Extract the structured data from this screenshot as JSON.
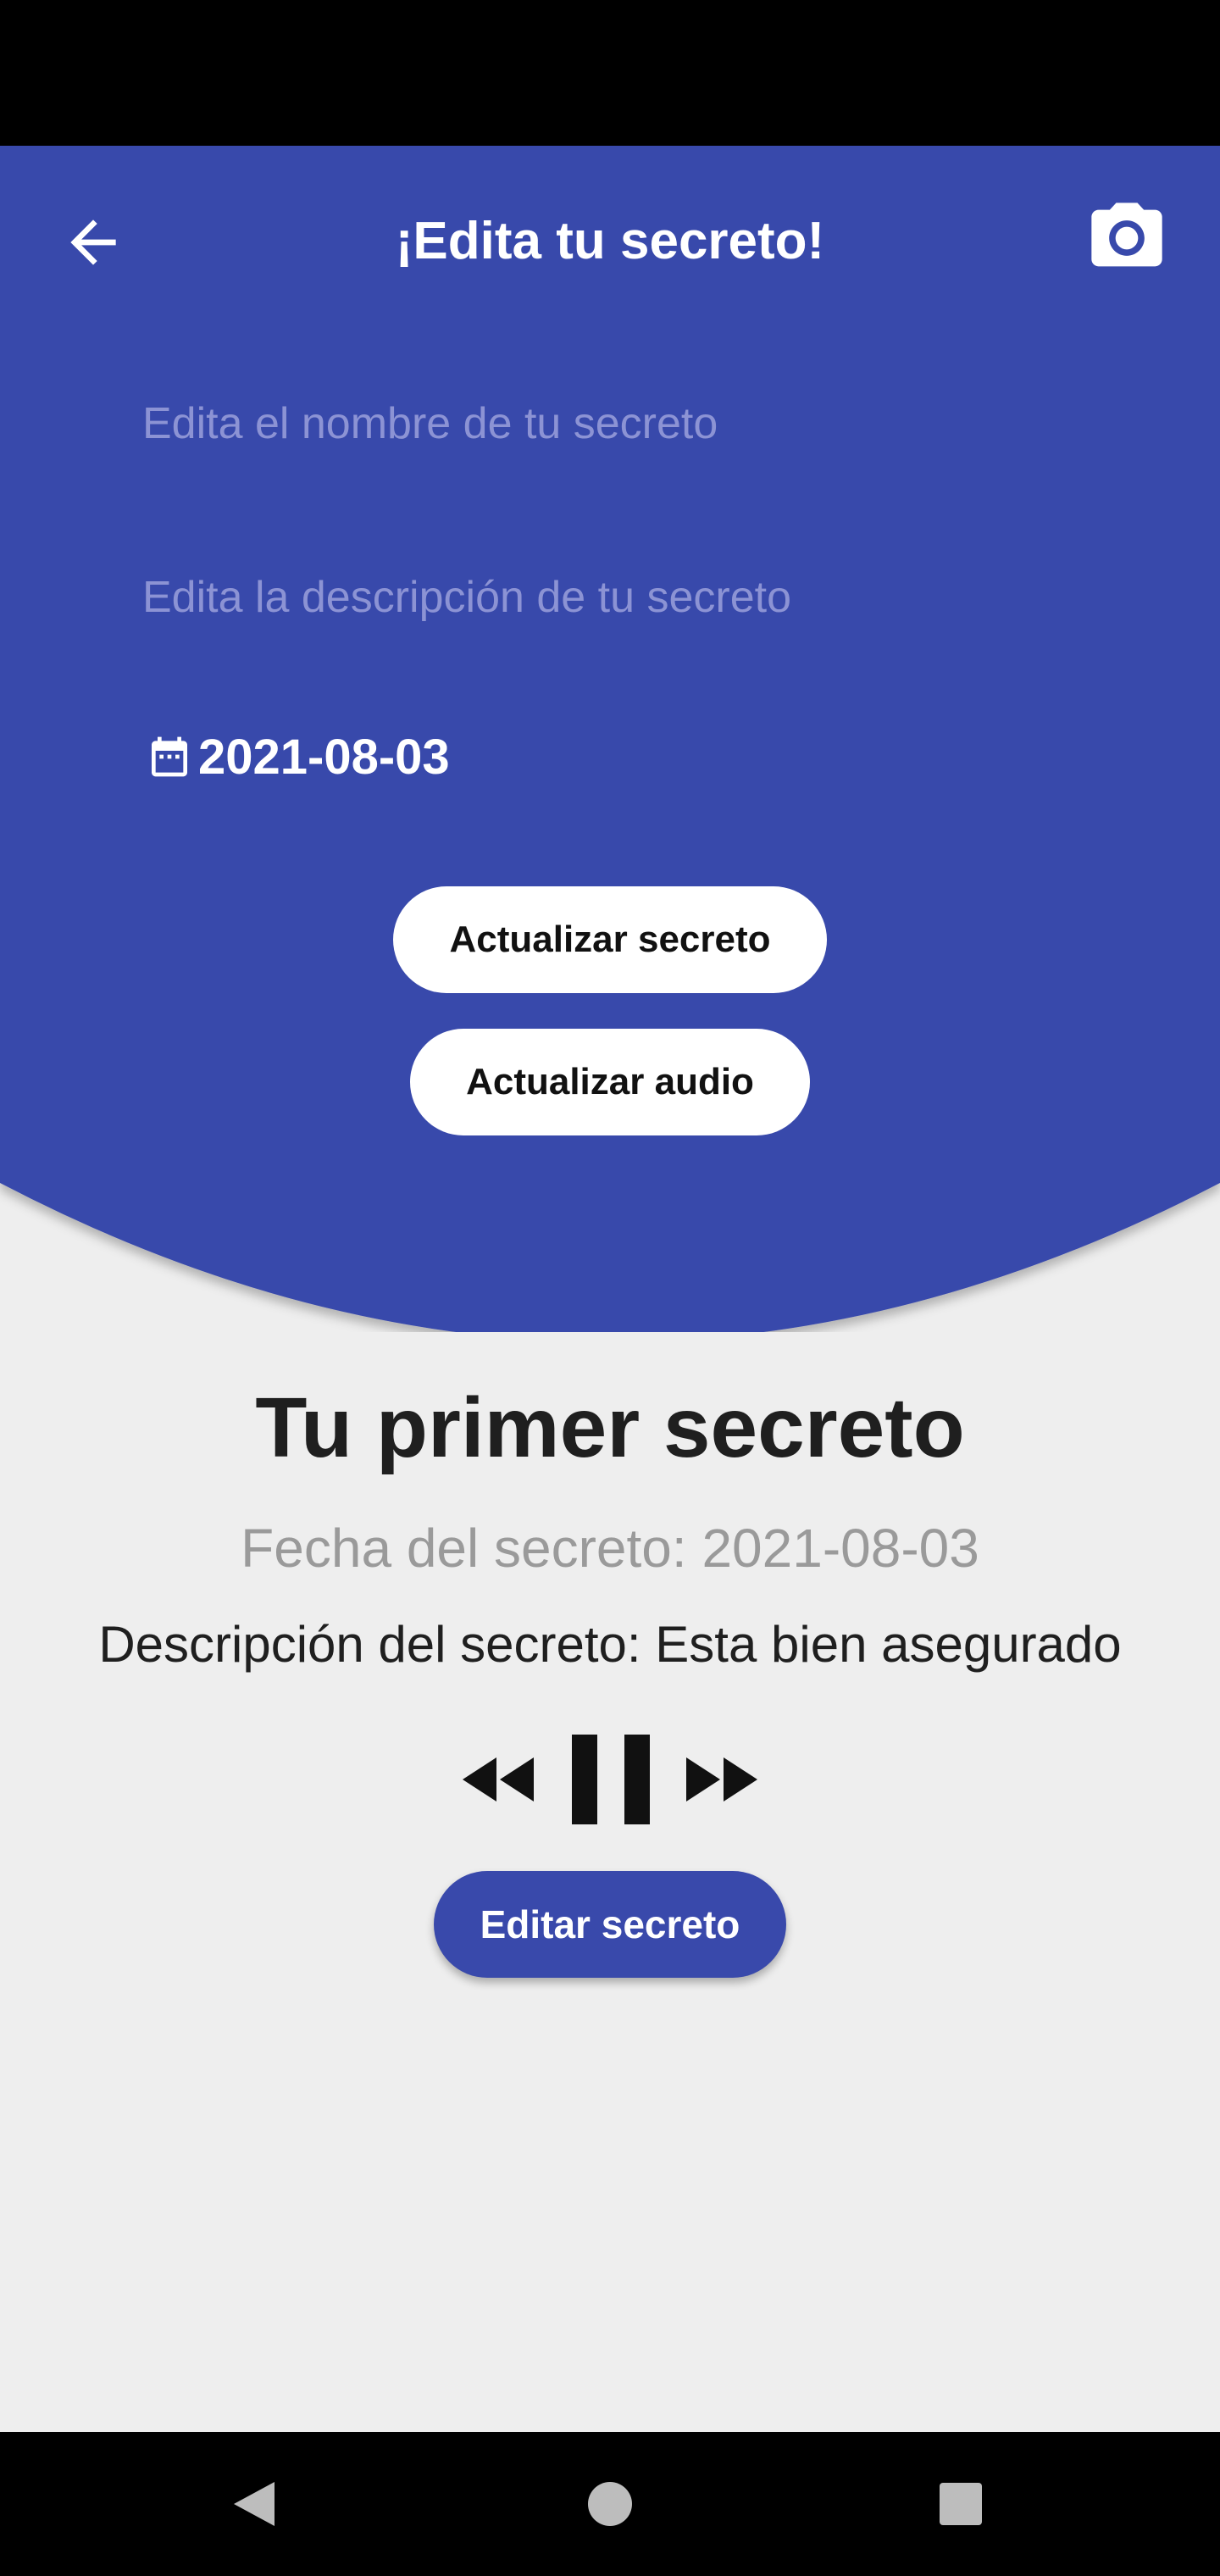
{
  "colors": {
    "primary": "#3949ab",
    "background": "#eeeeee",
    "white": "#ffffff",
    "placeholder": "#8c93d4",
    "muted_text": "#9a9a9a",
    "dark_text": "#1f1f1f",
    "system_bars": "#000000"
  },
  "header": {
    "title": "¡Edita tu secreto!",
    "back_icon": "arrow-left-icon",
    "camera_icon": "camera-icon"
  },
  "form": {
    "name_placeholder": "Edita el nombre de tu secreto",
    "name_value": "",
    "description_placeholder": "Edita la descripción de tu secreto",
    "description_value": "",
    "date_icon": "calendar-icon",
    "date_value": "2021-08-03",
    "update_secret_label": "Actualizar secreto",
    "update_audio_label": "Actualizar audio"
  },
  "secret": {
    "title": "Tu primer secreto",
    "date_line": "Fecha del secreto: 2021-08-03",
    "description_line": "Descripción del secreto: Esta bien asegurado"
  },
  "player": {
    "rewind_icon": "rewind-icon",
    "pause_icon": "pause-icon",
    "forward_icon": "fast-forward-icon"
  },
  "actions": {
    "edit_label": "Editar secreto"
  },
  "system_nav": {
    "back_icon": "nav-back-icon",
    "home_icon": "nav-home-icon",
    "recents_icon": "nav-recents-icon"
  }
}
